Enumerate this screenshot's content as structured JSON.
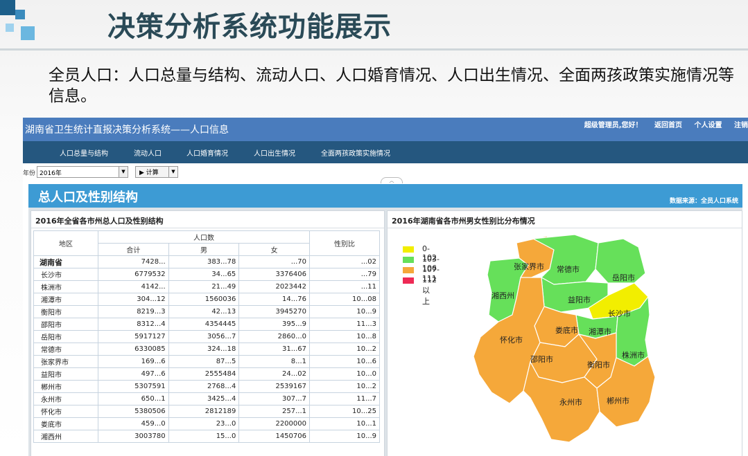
{
  "slide": {
    "title": "决策分析系统功能展示",
    "description": "全员人口：人口总量与结构、流动人口、人口婚育情况、人口出生情况、全面两孩政策实施情况等信息。"
  },
  "app": {
    "title": "湖南省卫生统计直报决策分析系统——人口信息",
    "greeting": "超级管理员,您好！",
    "links": [
      "返回首页",
      "个人设置",
      "注销"
    ]
  },
  "nav": {
    "items": [
      "人口总量与结构",
      "流动人口",
      "人口婚育情况",
      "人口出生情况",
      "全面两孩政策实施情况"
    ]
  },
  "toolbar": {
    "year_label": "年份",
    "year_value": "2016年",
    "calc_label": "▶ 计算"
  },
  "panel": {
    "title": "总人口及性别结构",
    "source": "数据来源：全员人口系统"
  },
  "table": {
    "title": "2016年全省各市州总人口及性别结构",
    "headers": {
      "region": "地区",
      "population": "人口数",
      "total": "合计",
      "male": "男",
      "female": "女",
      "ratio": "性别比"
    },
    "rows": [
      {
        "name": "湖南省",
        "total": "7428...",
        "male": "383...78",
        "female": "...70",
        "ratio": "...02"
      },
      {
        "name": "长沙市",
        "total": "6779532",
        "male": "34...65",
        "female": "3376406",
        "ratio": "...79"
      },
      {
        "name": "株洲市",
        "total": "4142...",
        "male": "21...49",
        "female": "2023442",
        "ratio": "...11"
      },
      {
        "name": "湘潭市",
        "total": "304...12",
        "male": "1560036",
        "female": "14...76",
        "ratio": "10...08"
      },
      {
        "name": "衡阳市",
        "total": "8219...3",
        "male": "42...13",
        "female": "3945270",
        "ratio": "10...9"
      },
      {
        "name": "邵阳市",
        "total": "8312...4",
        "male": "4354445",
        "female": "395...9",
        "ratio": "11...3"
      },
      {
        "name": "岳阳市",
        "total": "5917127",
        "male": "3056...7",
        "female": "2860...0",
        "ratio": "10...8"
      },
      {
        "name": "常德市",
        "total": "6330085",
        "male": "324...18",
        "female": "31...67",
        "ratio": "10...2"
      },
      {
        "name": "张家界市",
        "total": "169...6",
        "male": "87...5",
        "female": "8...1",
        "ratio": "10...6"
      },
      {
        "name": "益阳市",
        "total": "497...6",
        "male": "2555484",
        "female": "24...02",
        "ratio": "10...0"
      },
      {
        "name": "郴州市",
        "total": "5307591",
        "male": "2768...4",
        "female": "2539167",
        "ratio": "10...2"
      },
      {
        "name": "永州市",
        "total": "650...1",
        "male": "3425...4",
        "female": "307...7",
        "ratio": "11...7"
      },
      {
        "name": "怀化市",
        "total": "5380506",
        "male": "2812189",
        "female": "257...1",
        "ratio": "10...25"
      },
      {
        "name": "娄底市",
        "total": "459...0",
        "male": "23...0",
        "female": "2200000",
        "ratio": "10...1"
      },
      {
        "name": "湘西州",
        "total": "3003780",
        "male": "15...0",
        "female": "1450706",
        "ratio": "10...9"
      }
    ]
  },
  "map": {
    "title": "2016年湖南省各市州男女性别比分布情况",
    "legend": [
      {
        "label": "0-102",
        "color": "#f2ee00"
      },
      {
        "label": "103-106",
        "color": "#66e05a"
      },
      {
        "label": "107-111",
        "color": "#f5a83a"
      },
      {
        "label": "112以上",
        "color": "#ee2a55"
      }
    ],
    "cities": {
      "zhangjiajie": "张家界市",
      "changde": "常德市",
      "yueyang": "岳阳市",
      "xiangxi": "湘西州",
      "yiyang": "益阳市",
      "changsha": "长沙市",
      "huaihua": "怀化市",
      "loudi": "娄底市",
      "xiangtan": "湘潭市",
      "zhuzhou": "株洲市",
      "shaoyang": "邵阳市",
      "hengyang": "衡阳市",
      "yongzhou": "永州市",
      "chenzhou": "郴州市"
    }
  }
}
